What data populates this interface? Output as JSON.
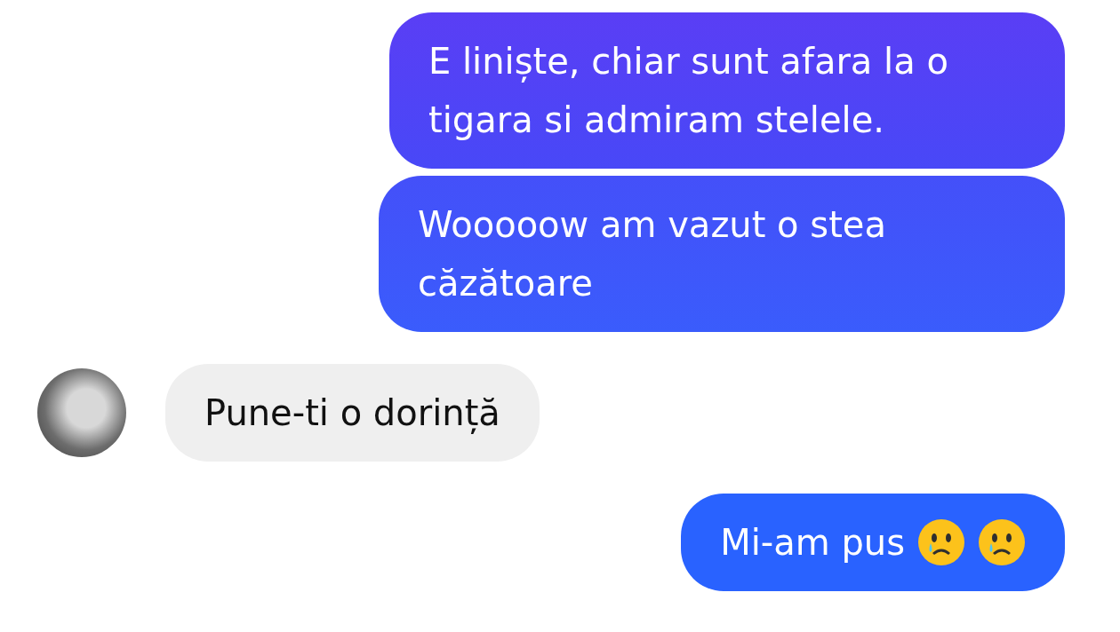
{
  "messages": [
    {
      "kind": "sent",
      "text": "E liniște, chiar sunt afara la o tigara si admiram stelele."
    },
    {
      "kind": "sent",
      "text": "Wooooow am vazut o stea căzătoare"
    },
    {
      "kind": "received",
      "text": "Pune-ti o dorință"
    },
    {
      "kind": "sent",
      "text": "Mi-am pus",
      "emojis": true
    }
  ]
}
